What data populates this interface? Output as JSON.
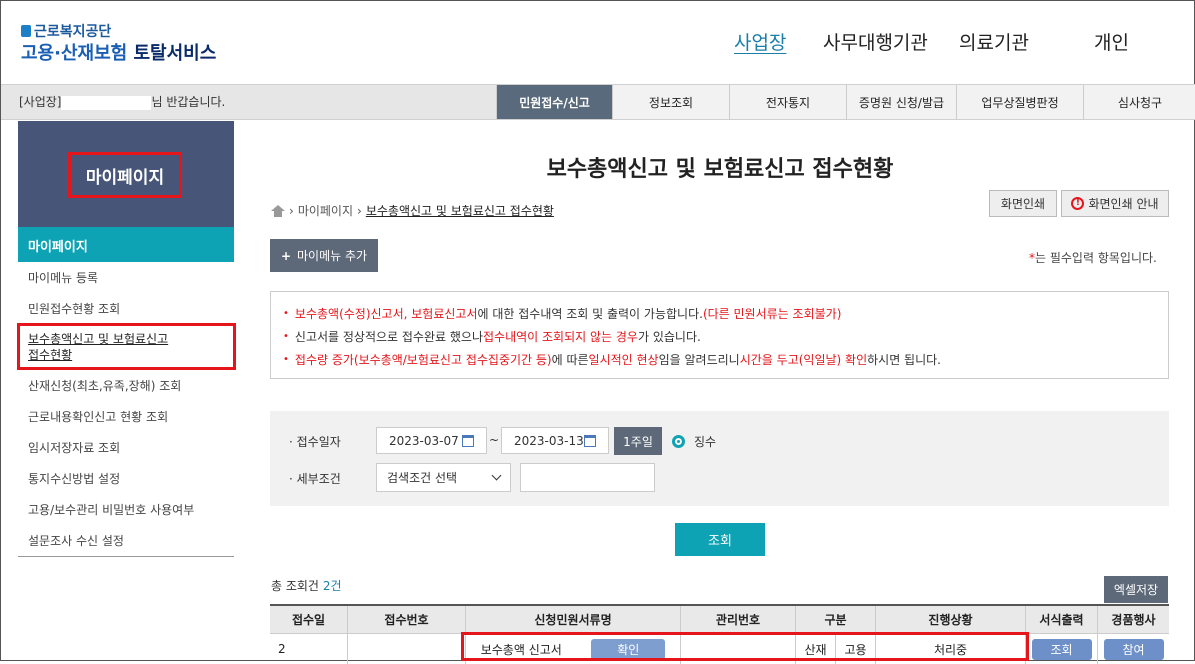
{
  "header": {
    "org_name": "근로복지공단",
    "service_name_blue": "고용·산재보험",
    "service_name_dark": "토탈서비스",
    "nav": [
      {
        "label": "사업장",
        "active": true
      },
      {
        "label": "사무대행기관",
        "active": false
      },
      {
        "label": "의료기관",
        "active": false
      },
      {
        "label": "개인",
        "active": false
      }
    ]
  },
  "welcome": {
    "prefix": "[사업장]",
    "suffix": "님 반갑습니다."
  },
  "menu_tabs": [
    {
      "label": "민원접수/신고",
      "active": true
    },
    {
      "label": "정보조회",
      "active": false
    },
    {
      "label": "전자통지",
      "active": false
    },
    {
      "label": "증명원 신청/발급",
      "active": false
    },
    {
      "label": "업무상질병판정",
      "active": false
    },
    {
      "label": "심사청구",
      "active": false
    }
  ],
  "sidebar": {
    "banner_title": "마이페이지",
    "section_title": "마이페이지",
    "items": [
      {
        "label": "마이메뉴 등록"
      },
      {
        "label": "민원접수현황 조회"
      },
      {
        "label": "보수총액신고 및 보험료신고 접수현황",
        "line1": "보수총액신고 및 보험료신고",
        "line2": "접수현황"
      },
      {
        "label": "산재신청(최초,유족,장해) 조회"
      },
      {
        "label": "근로내용확인신고 현황 조회"
      },
      {
        "label": "임시저장자료 조회"
      },
      {
        "label": "통지수신방법 설정"
      },
      {
        "label": "고용/보수관리 비밀번호 사용여부"
      },
      {
        "label": "설문조사 수신 설정"
      }
    ]
  },
  "main": {
    "title": "보수총액신고 및 보험료신고 접수현황",
    "breadcrumb": [
      "마이페이지",
      "보수총액신고 및 보험료신고 접수현황"
    ],
    "print_button": "화면인쇄",
    "print_guide_button": "화면인쇄 안내",
    "add_mymenu_button": "마이메뉴 추가",
    "required_note_star": "*",
    "required_note": "는 필수입력 항목입니다.",
    "notices": [
      {
        "a": "보수총액(수정)신고서, 보험료신고서",
        "b": "에 대한 접수내역 조회 및 출력이 가능합니다.",
        "c": "(다른 민원서류는 조회불가)"
      },
      {
        "a": "신고서를 정상적으로 접수완료 했으나 ",
        "b": "접수내역이 조회되지 않는 경우",
        "c": "가 있습니다."
      },
      {
        "a": "접수량 증가(보수총액/보험료신고 접수집중기간 등)",
        "b": "에 따른 ",
        "c": "일시적인 현상",
        "d": "임을 알려드리니 ",
        "e": "시간을 두고(익일날) 확인",
        "f": "하시면 됩니다."
      }
    ],
    "search": {
      "date_label": "접수일자",
      "date_from": "2023-03-07",
      "date_to": "2023-03-13",
      "range_sep": "~",
      "week_button": "1주일",
      "radio_label": "징수",
      "detail_label": "세부조건",
      "detail_select": "검색조건 선택",
      "detail_input": ""
    },
    "query_button": "조회",
    "total_label": "총 조회건",
    "total_count": "2건",
    "excel_button": "엑셀저장",
    "table": {
      "headers": [
        "접수일",
        "접수번호",
        "신청민원서류명",
        "관리번호",
        "구분",
        "진행상황",
        "서식출력",
        "경품행사"
      ],
      "rows": [
        {
          "date": "2",
          "number": "",
          "doc_name": "보수총액 신고서",
          "confirm": "확인",
          "mgmt_no": "",
          "type1": "산재",
          "type2": "고용",
          "status": "처리중",
          "print": "조회",
          "event": "참여"
        }
      ]
    }
  },
  "colors": {
    "accent_teal": "#0ea3b4",
    "nav_active": "#1a7fa8",
    "highlight_red": "#e4161b",
    "tab_active": "#5a6a7d"
  }
}
